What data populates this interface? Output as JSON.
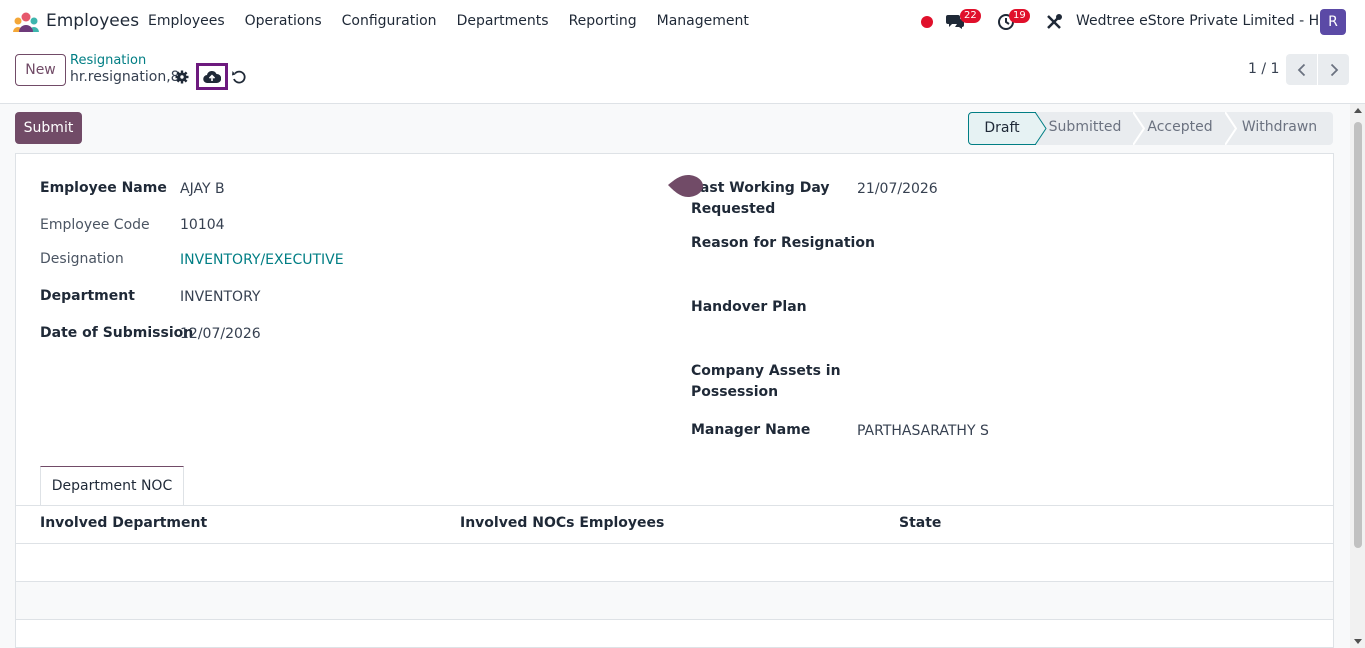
{
  "navbar": {
    "app_title": "Employees",
    "menu": [
      "Employees",
      "Operations",
      "Configuration",
      "Departments",
      "Reporting",
      "Management"
    ],
    "chat_count": "22",
    "activity_count": "19",
    "company": "Wedtree eStore Private Limited - HO",
    "avatar_letter": "R",
    "icons": [
      "app-logo-icon",
      "recording-dot-icon",
      "chat-icon",
      "clock-icon",
      "tools-icon"
    ]
  },
  "control_panel": {
    "new_label": "New",
    "breadcrumb_parent": "Resignation",
    "breadcrumb_current": "hr.resignation,8",
    "pager": "1 / 1",
    "icons": [
      "gear-icon",
      "cloud-upload-icon",
      "discard-icon",
      "chevron-left-icon",
      "chevron-right-icon"
    ]
  },
  "statusbar": {
    "submit_label": "Submit",
    "stages": [
      "Draft",
      "Submitted",
      "Accepted",
      "Withdrawn"
    ],
    "active_stage": "Draft"
  },
  "form": {
    "left": [
      {
        "label": "Employee Name",
        "value": "AJAY B"
      },
      {
        "label": "Employee Code",
        "value": "10104"
      },
      {
        "label": "Designation",
        "value": "INVENTORY/EXECUTIVE"
      },
      {
        "label": "Department",
        "value": "INVENTORY"
      },
      {
        "label": "Date of Submission",
        "value": "12/07/2026"
      }
    ],
    "right": [
      {
        "label_line1": "Last Working Day",
        "label_line2": "Requested",
        "value": "21/07/2026"
      },
      {
        "label": "Reason for Resignation",
        "value": ""
      },
      {
        "label": "Handover Plan",
        "value": ""
      },
      {
        "label_line1": "Company Assets in",
        "label_line2": "Possession",
        "value": ""
      },
      {
        "label": "Manager Name",
        "value": "PARTHASARATHY S"
      }
    ]
  },
  "notebook": {
    "tab_label": "Department NOC",
    "columns": [
      "Involved Department",
      "Involved NOCs Employees",
      "State"
    ],
    "rows": []
  },
  "colors": {
    "brand": "#714b67",
    "link": "#017e84",
    "badge": "#e0102b",
    "highlight_box": "#6d1a7e"
  }
}
